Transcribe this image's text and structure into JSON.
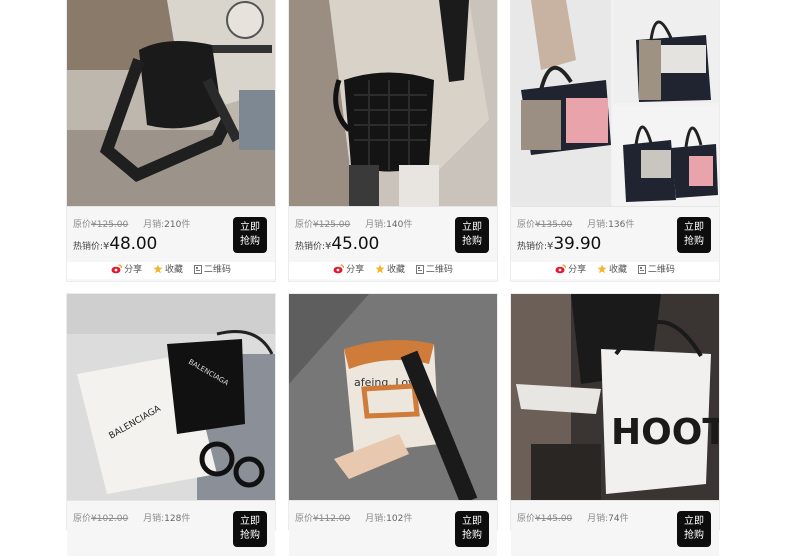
{
  "labels": {
    "orig_prefix": "原价",
    "sales_prefix": "月销:",
    "sales_suffix": "件",
    "hot_prefix": "热销价:",
    "yen": "¥",
    "buy_line1": "立即",
    "buy_line2": "抢购",
    "share": "分享",
    "fav": "收藏",
    "qr": "二维码"
  },
  "products": [
    {
      "orig_price": "¥125.00",
      "sales": "210",
      "price": "48.00"
    },
    {
      "orig_price": "¥125.00",
      "sales": "140",
      "price": "45.00"
    },
    {
      "orig_price": "¥135.00",
      "sales": "136",
      "price": "39.90"
    },
    {
      "orig_price": "¥102.00",
      "sales": "128"
    },
    {
      "orig_price": "¥112.00",
      "sales": "102"
    },
    {
      "orig_price": "¥145.00",
      "sales": "74"
    }
  ],
  "colors": {
    "buy_bg": "#0d0d0d",
    "weibo_red": "#e6162d",
    "star": "#f2b830"
  }
}
